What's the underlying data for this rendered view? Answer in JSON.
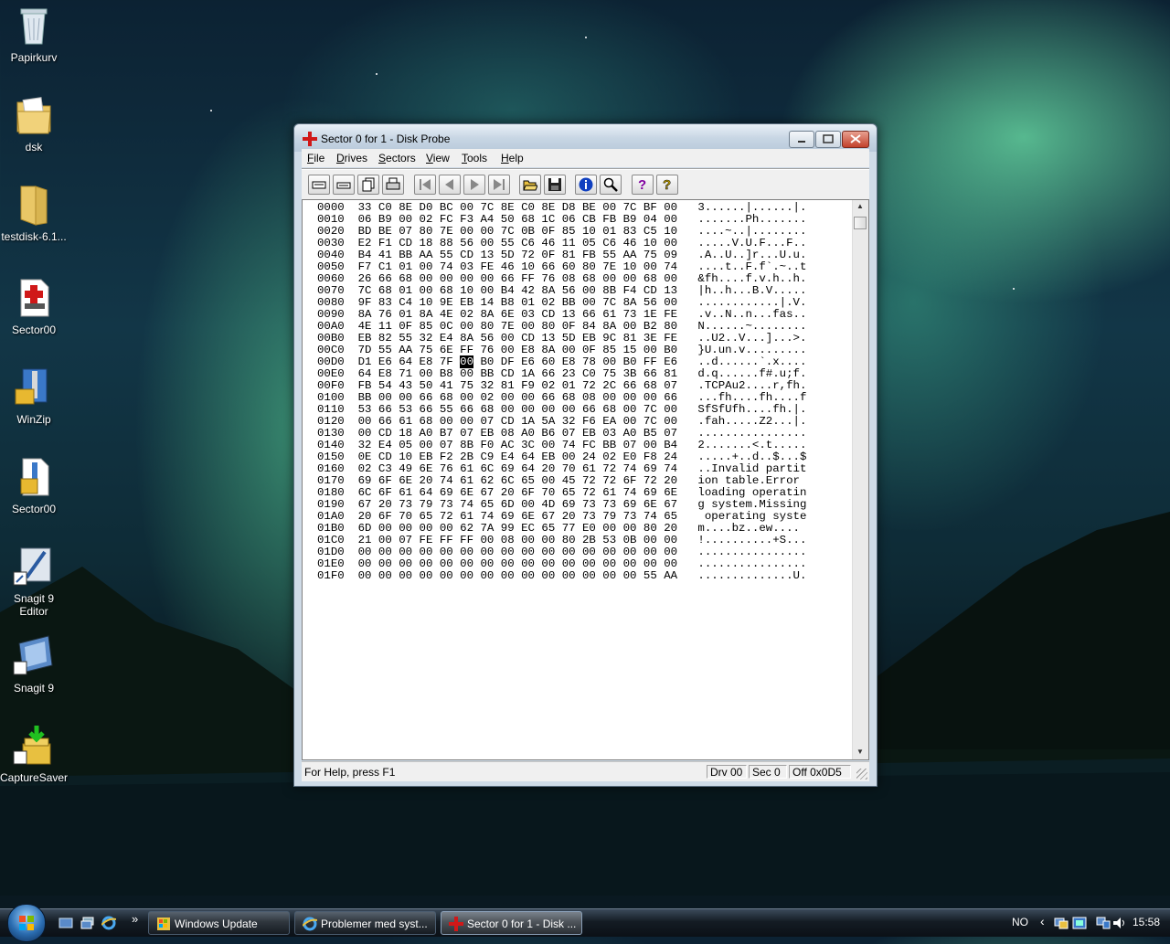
{
  "desktop": {
    "icons": [
      {
        "label": "Papirkurv",
        "icon": "recycle-bin-icon"
      },
      {
        "label": "dsk",
        "icon": "folder-icon"
      },
      {
        "label": "testdisk-6.1...",
        "icon": "folder-icon"
      },
      {
        "label": "Sector00",
        "icon": "disk-probe-file-icon"
      },
      {
        "label": "WinZip",
        "icon": "winzip-icon"
      },
      {
        "label": "Sector00",
        "icon": "zip-file-icon"
      },
      {
        "label": "Snagit 9 Editor",
        "icon": "snagit-editor-icon"
      },
      {
        "label": "Snagit 9",
        "icon": "snagit-icon"
      },
      {
        "label": "CaptureSaver",
        "icon": "capturesaver-icon"
      }
    ]
  },
  "window": {
    "title": "Sector 0 for 1 - Disk Probe",
    "menu": [
      {
        "key": "F",
        "rest": "ile"
      },
      {
        "key": "D",
        "rest": "rives"
      },
      {
        "key": "S",
        "rest": "ectors"
      },
      {
        "key": "V",
        "rest": "iew"
      },
      {
        "key": "T",
        "rest": "ools"
      },
      {
        "key": "H",
        "rest": "elp"
      }
    ],
    "toolbar_icons": [
      "read-sector-icon",
      "write-sector-icon",
      "copy-icon",
      "print-icon",
      "first-sector-icon",
      "previous-sector-icon",
      "next-sector-icon",
      "last-sector-icon",
      "open-file-icon",
      "save-icon",
      "info-icon",
      "search-icon",
      "help-icon",
      "context-help-icon"
    ],
    "hex_rows": [
      {
        "offset": "0000",
        "bytes": "33 C0 8E D0 BC 00 7C 8E C0 8E D8 BE 00 7C BF 00",
        "ascii": "3......|......|."
      },
      {
        "offset": "0010",
        "bytes": "06 B9 00 02 FC F3 A4 50 68 1C 06 CB FB B9 04 00",
        "ascii": ".......Ph......."
      },
      {
        "offset": "0020",
        "bytes": "BD BE 07 80 7E 00 00 7C 0B 0F 85 10 01 83 C5 10",
        "ascii": "....~..|........"
      },
      {
        "offset": "0030",
        "bytes": "E2 F1 CD 18 88 56 00 55 C6 46 11 05 C6 46 10 00",
        "ascii": ".....V.U.F...F.."
      },
      {
        "offset": "0040",
        "bytes": "B4 41 BB AA 55 CD 13 5D 72 0F 81 FB 55 AA 75 09",
        "ascii": ".A..U..]r...U.u."
      },
      {
        "offset": "0050",
        "bytes": "F7 C1 01 00 74 03 FE 46 10 66 60 80 7E 10 00 74",
        "ascii": "....t..F.f`.~..t"
      },
      {
        "offset": "0060",
        "bytes": "26 66 68 00 00 00 00 66 FF 76 08 68 00 00 68 00",
        "ascii": "&fh....f.v.h..h."
      },
      {
        "offset": "0070",
        "bytes": "7C 68 01 00 68 10 00 B4 42 8A 56 00 8B F4 CD 13",
        "ascii": "|h..h...B.V....."
      },
      {
        "offset": "0080",
        "bytes": "9F 83 C4 10 9E EB 14 B8 01 02 BB 00 7C 8A 56 00",
        "ascii": "............|.V."
      },
      {
        "offset": "0090",
        "bytes": "8A 76 01 8A 4E 02 8A 6E 03 CD 13 66 61 73 1E FE",
        "ascii": ".v..N..n...fas.."
      },
      {
        "offset": "00A0",
        "bytes": "4E 11 0F 85 0C 00 80 7E 00 80 0F 84 8A 00 B2 80",
        "ascii": "N......~........"
      },
      {
        "offset": "00B0",
        "bytes": "EB 82 55 32 E4 8A 56 00 CD 13 5D EB 9C 81 3E FE",
        "ascii": "..U2..V...]...>."
      },
      {
        "offset": "00C0",
        "bytes": "7D 55 AA 75 6E FF 76 00 E8 8A 00 0F 85 15 00 B0",
        "ascii": "}U.un.v........."
      },
      {
        "offset": "00D0",
        "bytes": "D1 E6 64 E8 7F 00 B0 DF E6 60 E8 78 00 B0 FF E6",
        "ascii": "..d......`.x...."
      },
      {
        "offset": "00E0",
        "bytes": "64 E8 71 00 B8 00 BB CD 1A 66 23 C0 75 3B 66 81",
        "ascii": "d.q......f#.u;f."
      },
      {
        "offset": "00F0",
        "bytes": "FB 54 43 50 41 75 32 81 F9 02 01 72 2C 66 68 07",
        "ascii": ".TCPAu2....r,fh."
      },
      {
        "offset": "0100",
        "bytes": "BB 00 00 66 68 00 02 00 00 66 68 08 00 00 00 66",
        "ascii": "...fh....fh....f"
      },
      {
        "offset": "0110",
        "bytes": "53 66 53 66 55 66 68 00 00 00 00 66 68 00 7C 00",
        "ascii": "SfSfUfh....fh.|."
      },
      {
        "offset": "0120",
        "bytes": "00 66 61 68 00 00 07 CD 1A 5A 32 F6 EA 00 7C 00",
        "ascii": ".fah.....Z2...|."
      },
      {
        "offset": "0130",
        "bytes": "00 CD 18 A0 B7 07 EB 08 A0 B6 07 EB 03 A0 B5 07",
        "ascii": "................"
      },
      {
        "offset": "0140",
        "bytes": "32 E4 05 00 07 8B F0 AC 3C 00 74 FC BB 07 00 B4",
        "ascii": "2.......<.t....."
      },
      {
        "offset": "0150",
        "bytes": "0E CD 10 EB F2 2B C9 E4 64 EB 00 24 02 E0 F8 24",
        "ascii": ".....+..d..$...$"
      },
      {
        "offset": "0160",
        "bytes": "02 C3 49 6E 76 61 6C 69 64 20 70 61 72 74 69 74",
        "ascii": "..Invalid partit"
      },
      {
        "offset": "0170",
        "bytes": "69 6F 6E 20 74 61 62 6C 65 00 45 72 72 6F 72 20",
        "ascii": "ion table.Error "
      },
      {
        "offset": "0180",
        "bytes": "6C 6F 61 64 69 6E 67 20 6F 70 65 72 61 74 69 6E",
        "ascii": "loading operatin"
      },
      {
        "offset": "0190",
        "bytes": "67 20 73 79 73 74 65 6D 00 4D 69 73 73 69 6E 67",
        "ascii": "g system.Missing"
      },
      {
        "offset": "01A0",
        "bytes": "20 6F 70 65 72 61 74 69 6E 67 20 73 79 73 74 65",
        "ascii": " operating syste"
      },
      {
        "offset": "01B0",
        "bytes": "6D 00 00 00 00 62 7A 99 EC 65 77 E0 00 00 80 20",
        "ascii": "m....bz..ew.... "
      },
      {
        "offset": "01C0",
        "bytes": "21 00 07 FE FF FF 00 08 00 00 80 2B 53 0B 00 00",
        "ascii": "!..........+S..."
      },
      {
        "offset": "01D0",
        "bytes": "00 00 00 00 00 00 00 00 00 00 00 00 00 00 00 00",
        "ascii": "................"
      },
      {
        "offset": "01E0",
        "bytes": "00 00 00 00 00 00 00 00 00 00 00 00 00 00 00 00",
        "ascii": "................"
      },
      {
        "offset": "01F0",
        "bytes": "00 00 00 00 00 00 00 00 00 00 00 00 00 00 55 AA",
        "ascii": "..............U."
      }
    ],
    "selected_byte": {
      "row": 13,
      "col": 5
    },
    "status": {
      "help": "For Help, press F1",
      "drive": "Drv 00",
      "sector": "Sec 0",
      "offset": "Off 0x0D5"
    }
  },
  "taskbar": {
    "overflow": "»",
    "tasks": [
      {
        "label": "Windows Update",
        "icon": "windows-update-icon",
        "active": false
      },
      {
        "label": "Problemer med syst...",
        "icon": "ie-icon",
        "active": false
      },
      {
        "label": "Sector 0 for 1 - Disk ...",
        "icon": "disk-probe-icon",
        "active": true
      }
    ],
    "language": "NO",
    "tray_chevron": "‹",
    "clock": "15:58"
  },
  "colors": {
    "title_icon_red": "#d01818",
    "selection": "#000000"
  }
}
